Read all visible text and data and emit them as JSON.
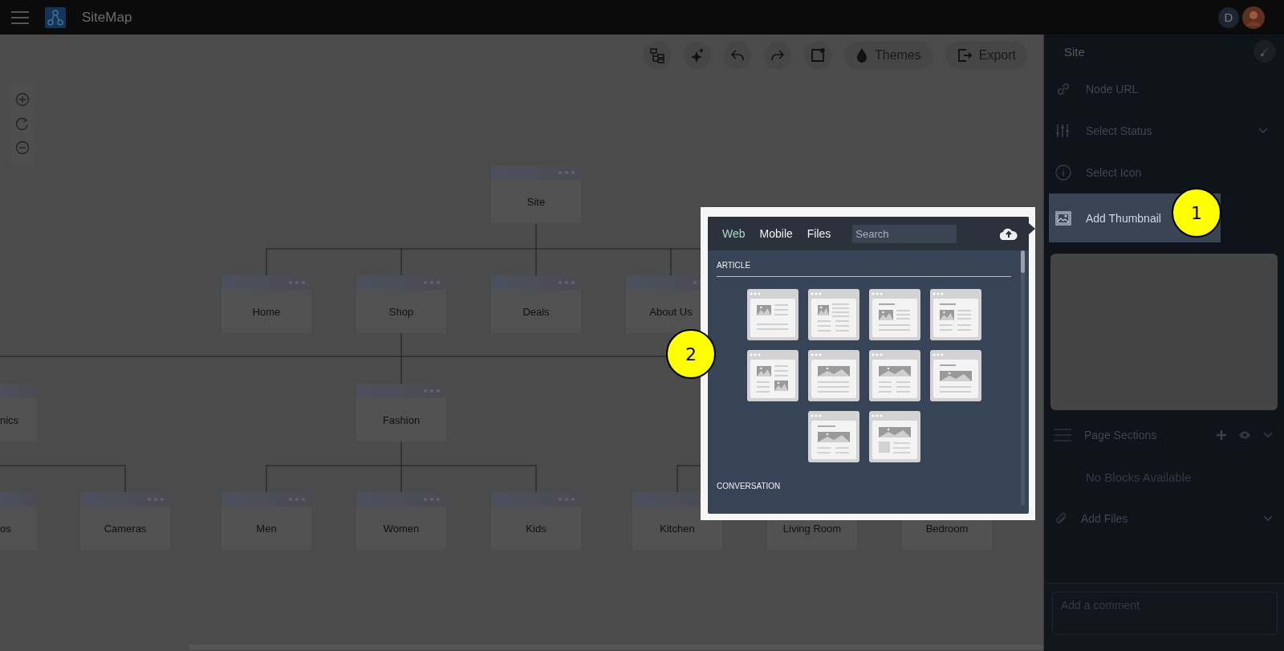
{
  "app": {
    "title": "SiteMap"
  },
  "avatars": [
    {
      "kind": "initial",
      "text": "D"
    },
    {
      "kind": "picture"
    }
  ],
  "toolbar": {
    "icon_buttons": [
      {
        "kind": "tree"
      },
      {
        "kind": "sparkle"
      },
      {
        "kind": "undo"
      },
      {
        "kind": "redo"
      },
      {
        "kind": "frame"
      }
    ],
    "text_buttons": [
      {
        "kind": "themes",
        "label": "Themes"
      },
      {
        "kind": "export",
        "label": "Export"
      }
    ]
  },
  "sitemap": {
    "levels": [
      [
        {
          "label": "Site"
        }
      ],
      [
        {
          "label": "Home"
        },
        {
          "label": "Shop"
        },
        {
          "label": "Deals"
        },
        {
          "label": "About Us"
        }
      ],
      [
        {
          "label": "nics"
        },
        {
          "label": "Fashion"
        }
      ],
      [
        {
          "label": "os"
        },
        {
          "label": "Cameras"
        },
        {
          "label": "Men"
        },
        {
          "label": "Women"
        },
        {
          "label": "Kids"
        },
        {
          "label": "Kitchen"
        },
        {
          "label": "Living Room"
        },
        {
          "label": "Bedroom"
        }
      ]
    ]
  },
  "picker": {
    "tabs": [
      {
        "label": "Web",
        "selected": true
      },
      {
        "label": "Mobile",
        "selected": false
      },
      {
        "label": "Files",
        "selected": false
      }
    ],
    "search": {
      "placeholder": "Search"
    },
    "groups": [
      {
        "title": "ARTICLE",
        "templates": [
          {
            "kind": "image-left"
          },
          {
            "kind": "image-left-columns"
          },
          {
            "kind": "title-image-left"
          },
          {
            "kind": "title-image-left-columns"
          },
          {
            "kind": "image-pair"
          },
          {
            "kind": "banner"
          },
          {
            "kind": "banner-columns"
          },
          {
            "kind": "title-banner"
          },
          {
            "kind": "title-banner-columns"
          },
          {
            "kind": "banner-block"
          }
        ]
      },
      {
        "title": "CONVERSATION"
      }
    ]
  },
  "panel": {
    "title": "Site",
    "fields": [
      {
        "kind": "link",
        "label": "Node URL",
        "dropdown": false,
        "selected": false
      },
      {
        "kind": "status",
        "label": "Select Status",
        "dropdown": true,
        "selected": false
      },
      {
        "kind": "info",
        "label": "Select Icon",
        "dropdown": false,
        "selected": false
      },
      {
        "kind": "thumbnail",
        "label": "Add Thumbnail",
        "dropdown": false,
        "selected": true
      }
    ],
    "sections": {
      "label": "Page Sections",
      "empty_text": "No Blocks Available"
    },
    "files": {
      "label": "Add Files"
    },
    "comment": {
      "placeholder": "Add a comment"
    }
  },
  "callouts": [
    {
      "label": "1"
    },
    {
      "label": "2"
    }
  ]
}
